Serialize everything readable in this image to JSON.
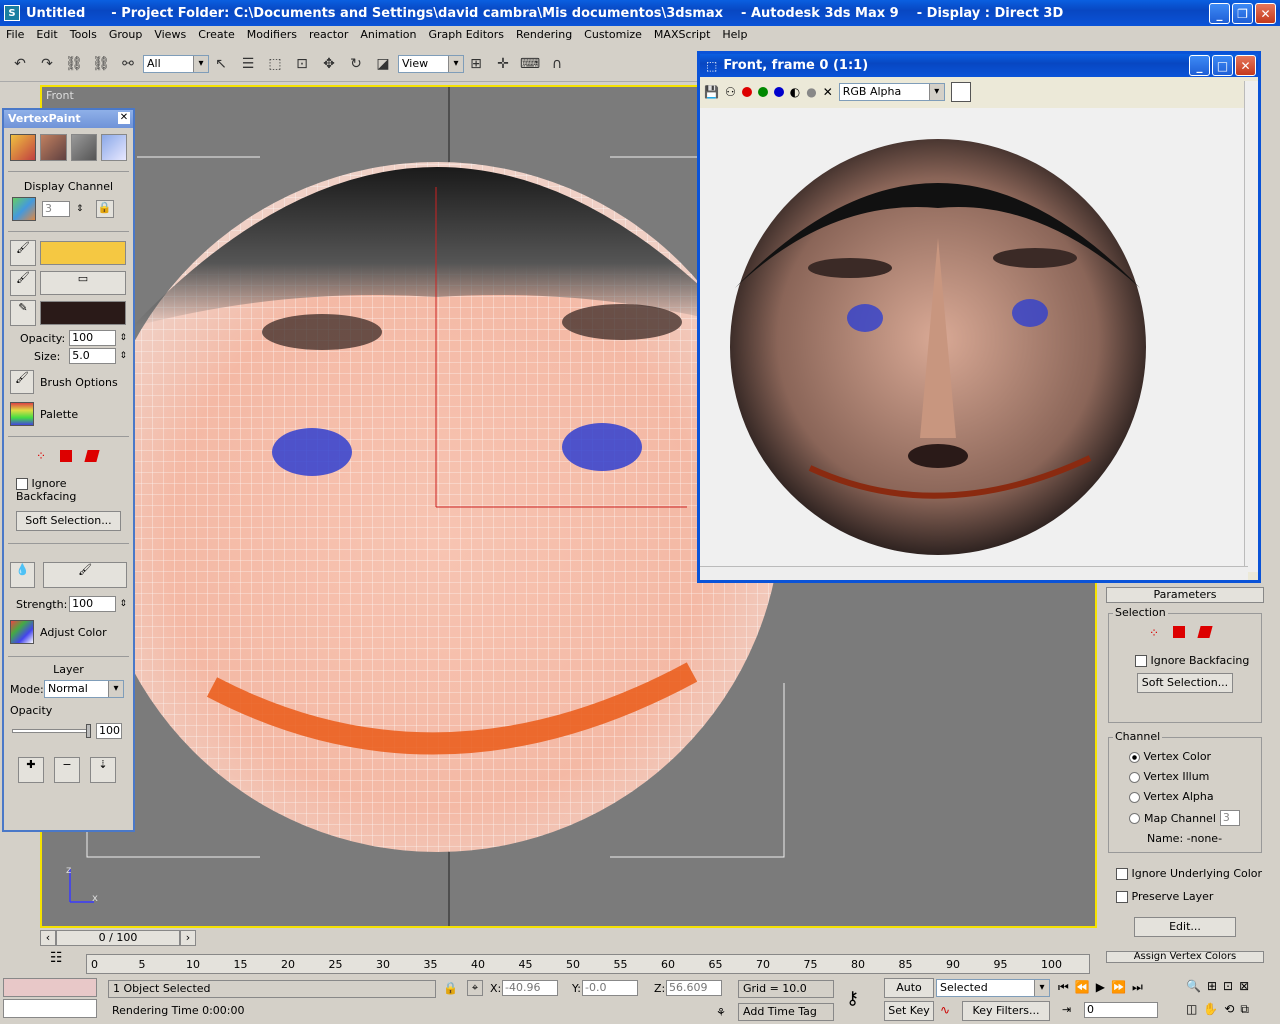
{
  "window": {
    "title": "Untitled",
    "project": "- Project Folder: C:\\Documents and Settings\\david cambra\\Mis documentos\\3dsmax",
    "app": "- Autodesk 3ds Max 9",
    "display": "- Display : Direct 3D"
  },
  "menu": [
    "File",
    "Edit",
    "Tools",
    "Group",
    "Views",
    "Create",
    "Modifiers",
    "reactor",
    "Animation",
    "Graph Editors",
    "Rendering",
    "Customize",
    "MAXScript",
    "Help"
  ],
  "toolbar": {
    "filter": "All",
    "coord": "View"
  },
  "viewport": {
    "label": "Front",
    "axis_z": "z",
    "axis_x": "x"
  },
  "vertexpaint": {
    "title": "VertexPaint",
    "display_channel": "Display Channel",
    "channel_value": "3",
    "opacity_label": "Opacity:",
    "opacity": "100",
    "size_label": "Size:",
    "size": "5.0",
    "brush_options": "Brush Options",
    "palette": "Palette",
    "ignore_backfacing": "Ignore Backfacing",
    "soft_selection": "Soft Selection...",
    "strength_label": "Strength:",
    "strength": "100",
    "adjust_color": "Adjust Color",
    "layer": "Layer",
    "mode_label": "Mode:",
    "mode": "Normal",
    "opacity2_label": "Opacity",
    "opacity2": "100",
    "paint_color": "#f5c842",
    "erase_color": "#2a1a18"
  },
  "render": {
    "title": "Front, frame 0 (1:1)",
    "channel": "RGB Alpha"
  },
  "params": {
    "header": "Parameters",
    "selection": "Selection",
    "ignore_backfacing": "Ignore Backfacing",
    "soft_selection": "Soft Selection...",
    "channel": "Channel",
    "vertex_color": "Vertex Color",
    "vertex_illum": "Vertex Illum",
    "vertex_alpha": "Vertex Alpha",
    "map_channel": "Map Channel",
    "map_value": "3",
    "name": "Name: -none-",
    "ignore_underlying": "Ignore Underlying Color",
    "preserve_layer": "Preserve Layer",
    "edit": "Edit...",
    "assign": "Assign Vertex Colors"
  },
  "timeline": {
    "slider": "0 / 100",
    "ticks": [
      "0",
      "5",
      "10",
      "15",
      "20",
      "25",
      "30",
      "35",
      "40",
      "45",
      "50",
      "55",
      "60",
      "65",
      "70",
      "75",
      "80",
      "85",
      "90",
      "95",
      "100"
    ]
  },
  "status": {
    "selected": "1 Object Selected",
    "rendering": "Rendering Time 0:00:00",
    "x_label": "X:",
    "x": "-40.96",
    "y_label": "Y:",
    "y": "-0.0",
    "z_label": "Z:",
    "z": "56.609",
    "grid": "Grid = 10.0",
    "add_time_tag": "Add Time Tag",
    "auto_key": "Auto Key",
    "set_key": "Set Key",
    "selected_mode": "Selected",
    "key_filters": "Key Filters...",
    "frame": "0"
  }
}
